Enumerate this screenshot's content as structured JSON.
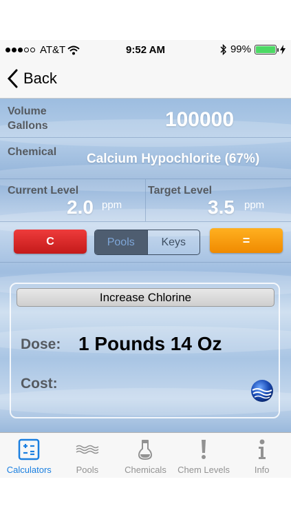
{
  "status_bar": {
    "carrier": "AT&T",
    "time": "9:52 AM",
    "battery": "99%",
    "battery_level": 0.99,
    "signal_bars": 3
  },
  "nav": {
    "back_label": "Back"
  },
  "calculator": {
    "volume_label_line1": "Volume",
    "volume_label_line2": "Gallons",
    "volume_value": "100000",
    "chemical_label": "Chemical",
    "chemical_value": "Calcium Hypochlorite (67%)",
    "current_level_label": "Current Level",
    "current_level_value": "2.0",
    "target_level_label": "Target Level",
    "target_level_value": "3.5",
    "unit": "ppm"
  },
  "buttons": {
    "clear_label": "C",
    "pools_label": "Pools",
    "keys_label": "Keys",
    "equals_label": "="
  },
  "result": {
    "header": "Increase Chlorine",
    "dose_label": "Dose:",
    "dose_value": "1 Pounds 14 Oz",
    "cost_label": "Cost:",
    "cost_value": ""
  },
  "tabs": [
    {
      "label": "Calculators",
      "icon": "calculator-icon",
      "active": true
    },
    {
      "label": "Pools",
      "icon": "water-waves-icon",
      "active": false
    },
    {
      "label": "Chemicals",
      "icon": "flask-icon",
      "active": false
    },
    {
      "label": "Chem Levels",
      "icon": "exclamation-icon",
      "active": false
    },
    {
      "label": "Info",
      "icon": "info-icon",
      "active": false
    }
  ],
  "colors": {
    "accent": "#1a7fe0",
    "clear_button": "#d42626",
    "equals_button": "#f89a10",
    "segment_active": "#4e5d70"
  }
}
